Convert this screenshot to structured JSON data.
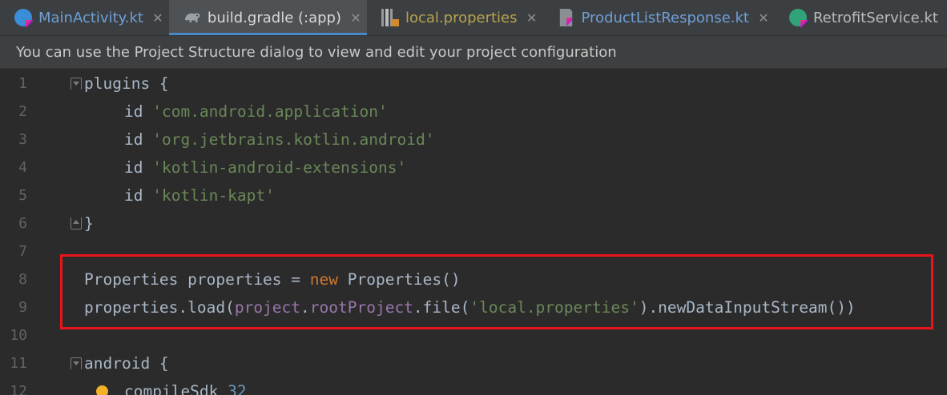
{
  "tabs": [
    {
      "label": "MainActivity.kt",
      "icon": "kotlin-class-icon",
      "active": false
    },
    {
      "label": "build.gradle (:app)",
      "icon": "gradle-elephant-icon",
      "active": true
    },
    {
      "label": "local.properties",
      "icon": "properties-file-icon",
      "active": false
    },
    {
      "label": "ProductListResponse.kt",
      "icon": "kotlin-file-icon",
      "active": false
    },
    {
      "label": "RetrofitService.kt",
      "icon": "kotlin-interface-icon",
      "active": false
    }
  ],
  "close_glyph": "✕",
  "notice": "You can use the Project Structure dialog to view and edit your project configuration",
  "line_numbers": [
    "1",
    "2",
    "3",
    "4",
    "5",
    "6",
    "7",
    "8",
    "9",
    "10",
    "11",
    "12"
  ],
  "code": {
    "l1": {
      "a": "plugins {"
    },
    "l2": {
      "kw": "id",
      "str": "'com.android.application'"
    },
    "l3": {
      "kw": "id",
      "str": "'org.jetbrains.kotlin.android'"
    },
    "l4": {
      "kw": "id",
      "str": "'kotlin-android-extensions'"
    },
    "l5": {
      "kw": "id",
      "str": "'kotlin-kapt'"
    },
    "l6": {
      "a": "}"
    },
    "l8": {
      "a": "Properties properties = ",
      "kw": "new",
      "b": " Properties()"
    },
    "l9": {
      "a": "properties.load(",
      "p1": "project",
      "dot1": ".",
      "p2": "rootProject",
      "b": ".file(",
      "str": "'local.properties'",
      "c": ").newDataInputStream())"
    },
    "l11": {
      "a": "android {"
    },
    "l12": {
      "a": "compileSdk ",
      "num": "32"
    }
  },
  "colors": {
    "highlight_border": "#e8161c",
    "keyword": "#cc7832",
    "string": "#6a8759",
    "property": "#9876aa",
    "number": "#6897bb"
  }
}
